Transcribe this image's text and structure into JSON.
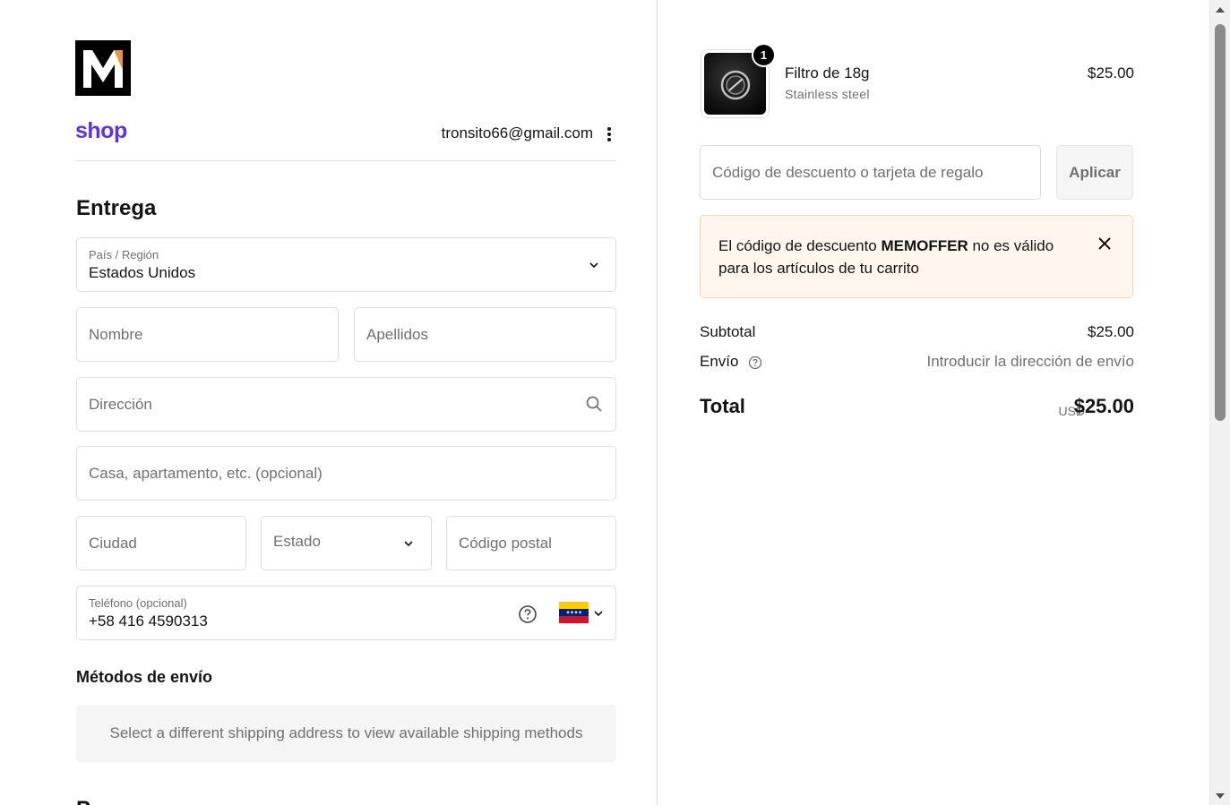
{
  "brand": {
    "logo_letter": "M",
    "shop_label": "shop",
    "accent_color": "#5a31f4"
  },
  "account": {
    "email": "tronsito66@gmail.com"
  },
  "delivery": {
    "heading": "Entrega",
    "country": {
      "label": "País / Región",
      "value": "Estados Unidos"
    },
    "first_name": {
      "placeholder": "Nombre"
    },
    "last_name": {
      "placeholder": "Apellidos"
    },
    "address": {
      "placeholder": "Dirección"
    },
    "apartment": {
      "placeholder": "Casa, apartamento, etc. (opcional)"
    },
    "city": {
      "placeholder": "Ciudad"
    },
    "state": {
      "placeholder": "Estado"
    },
    "postal": {
      "placeholder": "Código postal"
    },
    "phone": {
      "label": "Teléfono (opcional)",
      "value": "+58 416 4590313",
      "country_flag": "venezuela-flag"
    }
  },
  "shipping_methods": {
    "heading": "Métodos de envío",
    "message": "Select a different shipping address to view available shipping methods"
  },
  "next_heading": "P",
  "cart": {
    "item": {
      "quantity": "1",
      "name": "Filtro de 18g",
      "variant": "Stainless steel",
      "price": "$25.00"
    },
    "discount": {
      "placeholder": "Código de descuento o tarjeta de regalo",
      "apply_label": "Aplicar"
    },
    "alert": {
      "prefix": "El código de descuento ",
      "code": "MEMOFFER",
      "suffix": " no es válido para los artículos de tu carrito"
    },
    "subtotal": {
      "label": "Subtotal",
      "value": "$25.00"
    },
    "shipping": {
      "label": "Envío",
      "value": "Introducir la dirección de envío"
    },
    "total": {
      "label": "Total",
      "currency": "USD",
      "value": "$25.00"
    }
  }
}
